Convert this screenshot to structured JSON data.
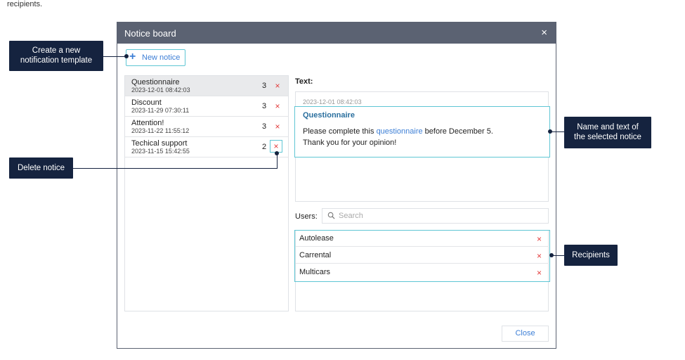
{
  "page": {
    "top_text": "recipients."
  },
  "dialog": {
    "title": "Notice board",
    "close_icon": "×",
    "new_notice_label": "New notice",
    "notices": [
      {
        "title": "Questionnaire",
        "date": "2023-12-01 08:42:03",
        "count": "3",
        "selected": true
      },
      {
        "title": "Discount",
        "date": "2023-11-29 07:30:11",
        "count": "3"
      },
      {
        "title": "Attention!",
        "date": "2023-11-22 11:55:12",
        "count": "3"
      },
      {
        "title": "Techical support",
        "date": "2023-11-15 15:42:55",
        "count": "2"
      }
    ],
    "delete_icon": "×",
    "text_label": "Text:",
    "message": {
      "date": "2023-12-01 08:42:03",
      "title": "Questionnaire",
      "line1_before": "Please complete this ",
      "line1_link": "questionnaire",
      "line1_after": " before December 5.",
      "line2": "Thank you for your opinion!"
    },
    "users_label": "Users:",
    "search_placeholder": "Search",
    "users": [
      "Autolease",
      "Carrental",
      "Multicars"
    ],
    "close_label": "Close"
  },
  "callouts": {
    "create_template": [
      "Create a new",
      "notification template"
    ],
    "delete_notice": [
      "Delete notice"
    ],
    "name_text": [
      "Name and text of",
      "the selected notice"
    ],
    "recipients": [
      "Recipients"
    ]
  },
  "colors": {
    "header": "#5b6272",
    "accent": "#5fc6d4",
    "link": "#3d7fd6",
    "delete": "#e23b3b",
    "callout": "#15233f"
  },
  "icons": {
    "plus": "plus-icon",
    "close": "close-icon",
    "search": "search-icon",
    "delete": "delete-x-icon"
  }
}
